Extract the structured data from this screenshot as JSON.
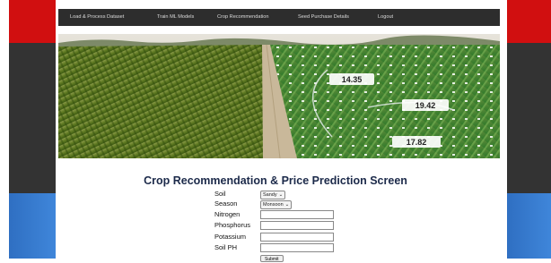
{
  "nav": {
    "items": [
      {
        "label": "Load & Process Dataset"
      },
      {
        "label": "Train ML Models"
      },
      {
        "label": "Crop Recommendation"
      },
      {
        "label": "Seed Purchase Details"
      },
      {
        "label": "Logout"
      }
    ]
  },
  "hero": {
    "values": [
      "14.35",
      "19.42",
      "17.82"
    ]
  },
  "form": {
    "title": "Crop Recommendation & Price Prediction Screen",
    "soil_label": "Soil",
    "soil_value": "Sandy",
    "season_label": "Season",
    "season_value": "Monsoon",
    "nitrogen_label": "Nitrogen",
    "phosphorus_label": "Phosphorus",
    "potassium_label": "Potassium",
    "soilph_label": "Soil PH",
    "submit_label": "Submit"
  },
  "colors": {
    "accent_red": "#d10f10",
    "panel_dark": "#333333",
    "accent_blue": "#3f86da",
    "nav_bg": "#2d2d2d"
  }
}
